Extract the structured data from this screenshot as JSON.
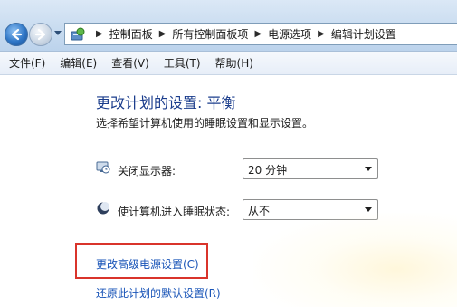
{
  "window": {
    "breadcrumbs": [
      "控制面板",
      "所有控制面板项",
      "电源选项",
      "编辑计划设置"
    ]
  },
  "menu": [
    "文件(F)",
    "编辑(E)",
    "查看(V)",
    "工具(T)",
    "帮助(H)"
  ],
  "page": {
    "title": "更改计划的设置: 平衡",
    "description": "选择希望计算机使用的睡眠设置和显示设置。"
  },
  "settings": {
    "display_off": {
      "label": "关闭显示器:",
      "value": "20 分钟",
      "icon": "monitor-clock-icon"
    },
    "sleep": {
      "label": "使计算机进入睡眠状态:",
      "value": "从不",
      "icon": "moon-sleep-icon"
    }
  },
  "links": {
    "advanced": "更改高级电源设置(C)",
    "restore": "还原此计划的默认设置(R)"
  },
  "colors": {
    "title": "#1a3c8c",
    "link": "#1a55b8",
    "highlight": "#d9342b"
  }
}
